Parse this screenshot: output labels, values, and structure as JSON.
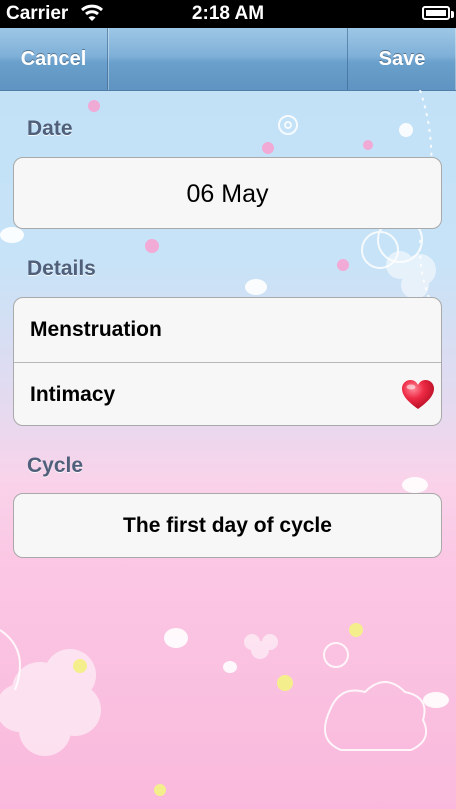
{
  "status_bar": {
    "carrier": "Carrier",
    "time": "2:18 AM",
    "wifi_icon": "wifi-icon",
    "battery_icon": "battery-icon"
  },
  "nav": {
    "cancel_label": "Cancel",
    "save_label": "Save"
  },
  "date_section": {
    "label": "Date",
    "value": "06 May"
  },
  "details_section": {
    "label": "Details",
    "items": [
      {
        "label": "Menstruation"
      },
      {
        "label": "Intimacy",
        "icon": "heart-icon"
      }
    ]
  },
  "cycle_section": {
    "label": "Cycle",
    "value": "The first day of cycle"
  },
  "colors": {
    "nav_blue": "#6aa0cc",
    "heart_red": "#e8203a",
    "label_gray": "#50607a"
  }
}
